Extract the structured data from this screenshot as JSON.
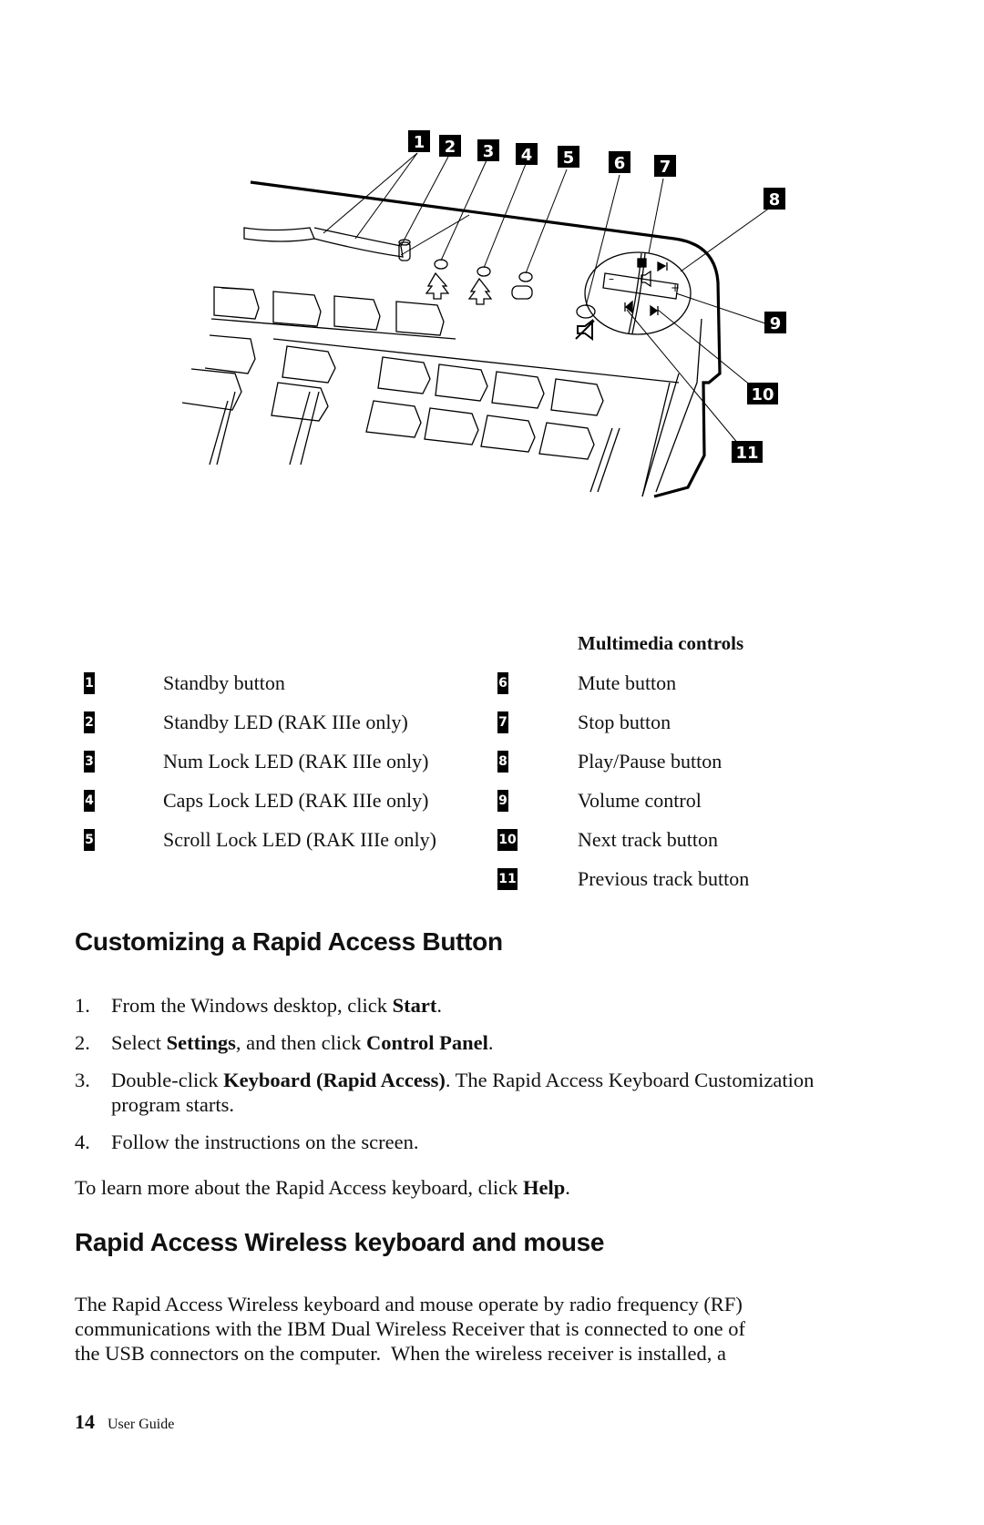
{
  "figure": {
    "description": "Rapid Access keyboard top-right corner illustration with numbered callouts",
    "callouts": [
      "1",
      "2",
      "3",
      "4",
      "5",
      "6",
      "7",
      "8",
      "9",
      "10",
      "11"
    ],
    "icons": [
      "num-lock-icon",
      "caps-lock-icon",
      "scroll-lock-icon",
      "mute-icon",
      "stop-icon",
      "play-pause-icon",
      "volume-icon",
      "previous-track-icon",
      "next-track-icon"
    ]
  },
  "legend": {
    "multimedia_heading": "Multimedia controls",
    "left": [
      {
        "num": "1",
        "label": "Standby button"
      },
      {
        "num": "2",
        "label": "Standby LED (RAK IIIe only)"
      },
      {
        "num": "3",
        "label": "Num Lock LED (RAK IIIe only)"
      },
      {
        "num": "4",
        "label": "Caps Lock LED (RAK IIIe only)"
      },
      {
        "num": "5",
        "label": "Scroll Lock LED (RAK IIIe only)"
      }
    ],
    "right": [
      {
        "num": "6",
        "label": "Mute button"
      },
      {
        "num": "7",
        "label": "Stop button"
      },
      {
        "num": "8",
        "label": "Play/Pause button"
      },
      {
        "num": "9",
        "label": "Volume control"
      },
      {
        "num": "10",
        "label": "Next track button"
      },
      {
        "num": "11",
        "label": "Previous track button"
      }
    ]
  },
  "section1": {
    "heading": "Customizing a Rapid Access Button",
    "steps": [
      {
        "num": "1.",
        "parts": [
          {
            "t": "From the Windows desktop, click "
          },
          {
            "b": "Start"
          },
          {
            "t": "."
          }
        ]
      },
      {
        "num": "2.",
        "parts": [
          {
            "t": "Select "
          },
          {
            "b": "Settings"
          },
          {
            "t": ", and then click "
          },
          {
            "b": "Control Panel"
          },
          {
            "t": "."
          }
        ]
      },
      {
        "num": "3.",
        "parts": [
          {
            "t": "Double-click "
          },
          {
            "b": "Keyboard (Rapid Access)"
          },
          {
            "t": ". The Rapid Access Keyboard Customization program starts."
          }
        ]
      },
      {
        "num": "4.",
        "parts": [
          {
            "t": "Follow the instructions on the screen."
          }
        ]
      }
    ],
    "help_note": [
      {
        "t": "To learn more about the Rapid Access keyboard, click "
      },
      {
        "b": "Help"
      },
      {
        "t": "."
      }
    ]
  },
  "section2": {
    "heading": "Rapid Access Wireless keyboard and mouse",
    "paragraph_lines": [
      "The Rapid Access Wireless keyboard and mouse operate by radio frequency (RF)",
      "communications with the IBM Dual Wireless Receiver that is connected to one of",
      "the USB connectors on the computer.  When the wireless receiver is installed, a"
    ]
  },
  "footer": {
    "page_number": "14",
    "book_title": "User Guide"
  }
}
